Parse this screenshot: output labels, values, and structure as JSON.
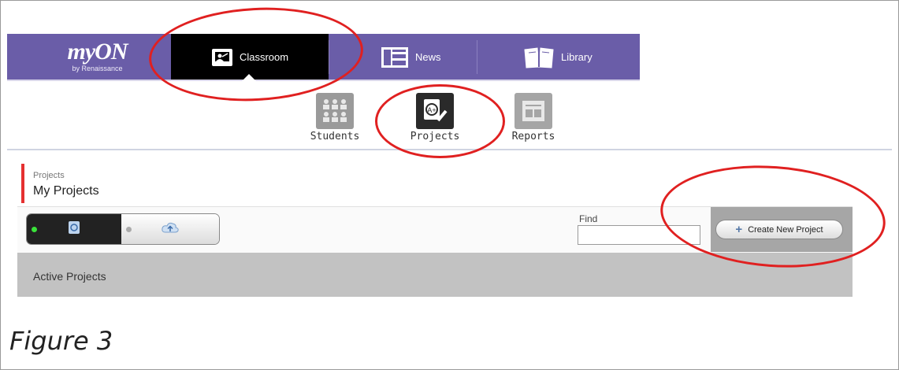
{
  "topnav": {
    "logo_main": "myON",
    "logo_sub": "by Renaissance",
    "tabs": [
      {
        "label": "Classroom",
        "icon": "presenter-icon",
        "selected": true
      },
      {
        "label": "News",
        "icon": "newspaper-icon"
      },
      {
        "label": "Library",
        "icon": "open-book-icon"
      }
    ]
  },
  "subnav": {
    "items": [
      {
        "label": "Students",
        "icon": "students-icon"
      },
      {
        "label": "Projects",
        "icon": "projects-icon",
        "selected": true
      },
      {
        "label": "Reports",
        "icon": "reports-icon"
      }
    ]
  },
  "page": {
    "breadcrumb": "Projects",
    "title": "My Projects"
  },
  "toolbar": {
    "view_toggle": {
      "left_icon": "project-doc-icon",
      "right_icon": "cloud-upload-icon",
      "active": "left"
    },
    "find_label": "Find",
    "find_value": "",
    "create_label": "Create New Project"
  },
  "projects": {
    "active_label": "Active Projects"
  },
  "caption": "Figure 3",
  "colors": {
    "nav_purple": "#6a5da8",
    "selected_tab": "#000000",
    "accent_red": "#e53030",
    "annotation_red": "#e02020",
    "status_green": "#3ae33a"
  }
}
